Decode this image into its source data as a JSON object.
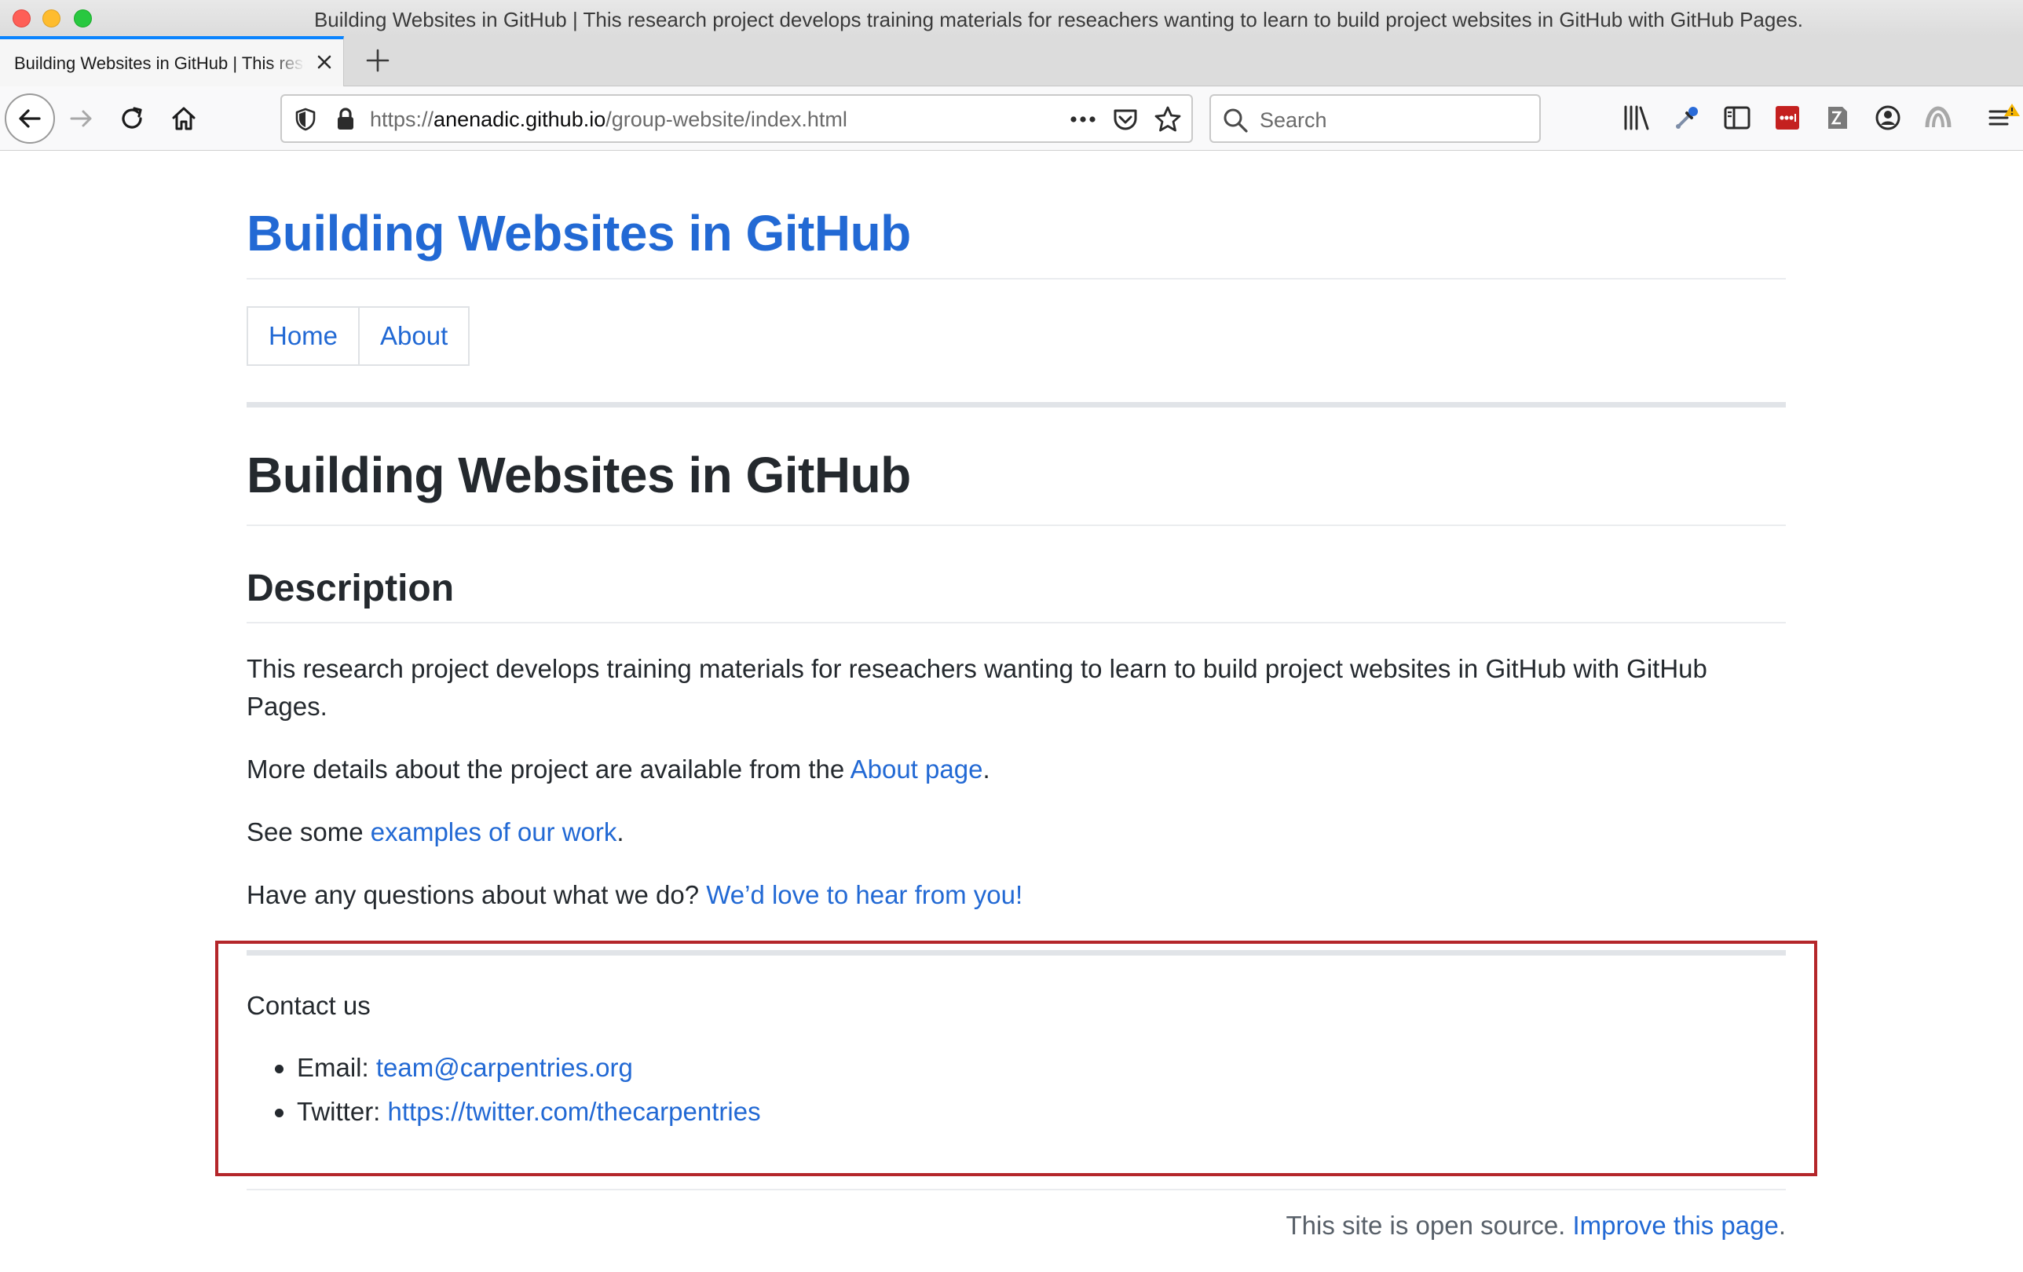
{
  "window": {
    "title": "Building Websites in GitHub | This research project develops training materials for reseachers wanting to learn to build project websites in GitHub with GitHub Pages."
  },
  "tab": {
    "title": "Building Websites in GitHub | This research project develops training materials for reseachers wanting to learn to build project websites in GitHub with GitHub Pages."
  },
  "urlbar": {
    "protocol": "https://",
    "domain": "anenadic.github.io",
    "path": "/group-website/index.html"
  },
  "searchbar": {
    "placeholder": "Search"
  },
  "page": {
    "site_title": "Building Websites in GitHub",
    "nav": [
      {
        "label": "Home"
      },
      {
        "label": "About"
      }
    ],
    "heading": "Building Websites in GitHub",
    "subheading": "Description",
    "description": "This research project develops training materials for reseachers wanting to learn to build project websites in GitHub with GitHub Pages.",
    "about_para": {
      "prefix": "More details about the project are available from the ",
      "link": "About page",
      "suffix": "."
    },
    "examples_para": {
      "prefix": "See some ",
      "link": "examples of our work",
      "suffix": "."
    },
    "questions_para": {
      "prefix": "Have any questions about what we do? ",
      "link": "We’d love to hear from you!"
    },
    "contact": {
      "heading": "Contact us",
      "email_label": "Email: ",
      "email": "team@carpentries.org",
      "twitter_label": "Twitter: ",
      "twitter": "https://twitter.com/thecarpentries"
    },
    "footer": {
      "text": "This site is open source. ",
      "link": "Improve this page",
      "suffix": "."
    }
  },
  "colors": {
    "link": "#2269d4",
    "highlight_border": "#b4262a",
    "tab_accent": "#0a84ff"
  }
}
